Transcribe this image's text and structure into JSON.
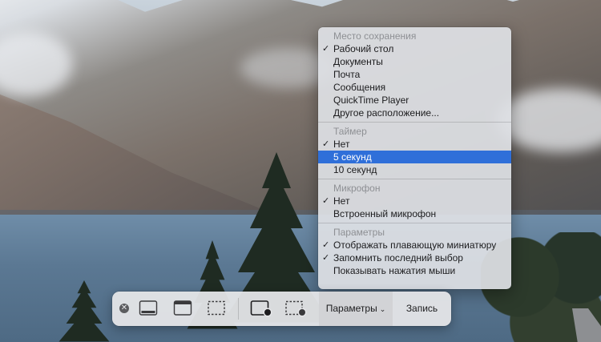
{
  "menu": {
    "sections": [
      {
        "header": "Место сохранения",
        "items": [
          {
            "label": "Рабочий стол",
            "checked": true,
            "selected": false
          },
          {
            "label": "Документы",
            "checked": false,
            "selected": false
          },
          {
            "label": "Почта",
            "checked": false,
            "selected": false
          },
          {
            "label": "Сообщения",
            "checked": false,
            "selected": false
          },
          {
            "label": "QuickTime Player",
            "checked": false,
            "selected": false
          },
          {
            "label": "Другое расположение...",
            "checked": false,
            "selected": false
          }
        ]
      },
      {
        "header": "Таймер",
        "items": [
          {
            "label": "Нет",
            "checked": true,
            "selected": false
          },
          {
            "label": "5 секунд",
            "checked": false,
            "selected": true
          },
          {
            "label": "10 секунд",
            "checked": false,
            "selected": false
          }
        ]
      },
      {
        "header": "Микрофон",
        "items": [
          {
            "label": "Нет",
            "checked": true,
            "selected": false
          },
          {
            "label": "Встроенный микрофон",
            "checked": false,
            "selected": false
          }
        ]
      },
      {
        "header": "Параметры",
        "items": [
          {
            "label": "Отображать плавающую миниатюру",
            "checked": true,
            "selected": false
          },
          {
            "label": "Запомнить последний выбор",
            "checked": true,
            "selected": false
          },
          {
            "label": "Показывать нажатия мыши",
            "checked": false,
            "selected": false
          }
        ]
      }
    ],
    "check_glyph": "✓"
  },
  "toolbar": {
    "close_glyph": "✕",
    "tools": [
      {
        "name": "capture-entire-screen-icon"
      },
      {
        "name": "capture-window-icon"
      },
      {
        "name": "capture-selection-icon"
      },
      {
        "name": "record-entire-screen-icon"
      },
      {
        "name": "record-selection-icon"
      }
    ],
    "options_label": "Параметры",
    "options_chevron": "⌄",
    "record_label": "Запись"
  },
  "colors": {
    "selection": "#2f6fd9",
    "menu_background": "#dee0e4",
    "toolbar_background": "#e6e7e9"
  }
}
